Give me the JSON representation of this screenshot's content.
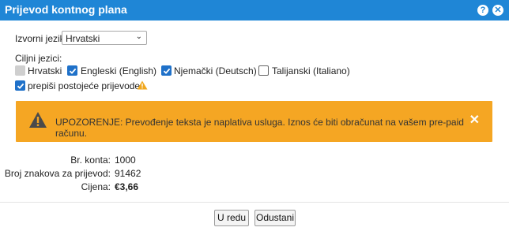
{
  "dialog": {
    "title": "Prijevod kontnog plana",
    "help_icon": "help-icon",
    "close_icon": "close-icon"
  },
  "source": {
    "label": "Izvorni jezik:",
    "selected": "Hrvatski"
  },
  "targets": {
    "label": "Ciljni jezici:",
    "options": [
      {
        "label": "Hrvatski",
        "state": "disabled"
      },
      {
        "label": "Engleski (English)",
        "state": "checked"
      },
      {
        "label": "Njemački (Deutsch)",
        "state": "checked"
      },
      {
        "label": "Talijanski (Italiano)",
        "state": "unchecked"
      }
    ]
  },
  "overwrite": {
    "label": "prepiši postojeće prijevode",
    "checked": true,
    "icon": "warning-icon"
  },
  "alert": {
    "text": "UPOZORENJE: Prevođenje teksta je naplativa usluga. Iznos će biti obračunat na vašem pre-paid računu.",
    "background": "#f5a623"
  },
  "summary": {
    "account_label": "Br. konta:",
    "account_value": "1000",
    "chars_label": "Broj znakova za prijevod:",
    "chars_value": "91462",
    "price_label": "Cijena:",
    "price_value": "€3,66"
  },
  "buttons": {
    "ok": "U redu",
    "cancel": "Odustani"
  },
  "colors": {
    "titlebar": "#1f86d6",
    "checkbox": "#1f71c9",
    "alert": "#f5a623"
  }
}
